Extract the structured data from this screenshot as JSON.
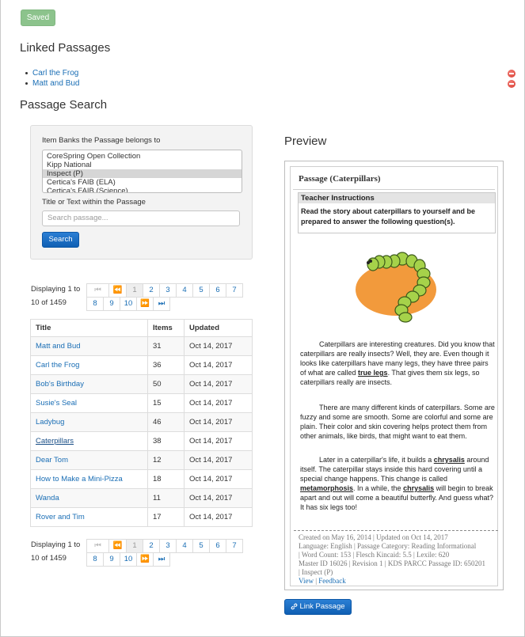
{
  "saved_button": "Saved",
  "linked": {
    "heading": "Linked Passages",
    "items": [
      "Carl the Frog",
      "Matt and Bud"
    ]
  },
  "search": {
    "heading": "Passage Search",
    "banks_label": "Item Banks the Passage belongs to",
    "banks": [
      {
        "label": "CoreSpring Open Collection",
        "selected": false
      },
      {
        "label": "Kipp National",
        "selected": false
      },
      {
        "label": "Inspect (P)",
        "selected": true
      },
      {
        "label": "Certica's FAIB (ELA)",
        "selected": false
      },
      {
        "label": "Certica's FAIB (Science)",
        "selected": false
      }
    ],
    "title_label": "Title or Text within the Passage",
    "input_placeholder": "Search passage...",
    "input_value": "",
    "search_button": "Search"
  },
  "pagination": {
    "displaying_line1": "Displaying 1 to",
    "displaying_line2": "10 of 1459",
    "first": "⏮",
    "prev": "⏪",
    "pages": [
      "1",
      "2",
      "3",
      "4",
      "5",
      "6",
      "7",
      "8",
      "9",
      "10"
    ],
    "active_page": "1",
    "next": "⏩",
    "last": "⏭"
  },
  "table": {
    "columns": [
      "Title",
      "Items",
      "Updated"
    ],
    "rows": [
      {
        "title": "Matt and Bud",
        "items": "31",
        "updated": "Oct 14, 2017"
      },
      {
        "title": "Carl the Frog",
        "items": "36",
        "updated": "Oct 14, 2017"
      },
      {
        "title": "Bob's Birthday",
        "items": "50",
        "updated": "Oct 14, 2017"
      },
      {
        "title": "Susie's Seal",
        "items": "15",
        "updated": "Oct 14, 2017"
      },
      {
        "title": "Ladybug",
        "items": "46",
        "updated": "Oct 14, 2017"
      },
      {
        "title": "Caterpillars",
        "items": "38",
        "updated": "Oct 14, 2017"
      },
      {
        "title": "Dear Tom",
        "items": "12",
        "updated": "Oct 14, 2017"
      },
      {
        "title": "How to Make a Mini-Pizza",
        "items": "18",
        "updated": "Oct 14, 2017"
      },
      {
        "title": "Wanda",
        "items": "11",
        "updated": "Oct 14, 2017"
      },
      {
        "title": "Rover and Tim",
        "items": "17",
        "updated": "Oct 14, 2017"
      }
    ],
    "current_title": "Caterpillars"
  },
  "preview": {
    "heading": "Preview",
    "passage_title": "Passage (Caterpillars)",
    "teacher_instructions_heading": "Teacher Instructions",
    "teacher_instructions_text": "Read the story about caterpillars to yourself and be prepared to answer the following question(s).",
    "para1_a": "Caterpillars are interesting creatures.  Did you know that caterpillars are really insects?  Well, they are.  Even though it looks like caterpillars have many legs, they have three pairs of what are called ",
    "para1_kw": "true legs",
    "para1_b": ".  That gives them six legs, so caterpillars really are insects.",
    "para2": "There are many different kinds of caterpillars.  Some are fuzzy and some are smooth.  Some are colorful and some are plain.  Their color and skin covering helps protect them from other animals, like birds, that might want to eat them.",
    "para3_a": "Later in a caterpillar's life, it builds a ",
    "para3_kw1": "chrysalis",
    "para3_b": " around itself. The caterpillar stays inside this hard covering until a special change happens.  This change is called ",
    "para3_kw2": "metamorphosis",
    "para3_c": ".  In a while, the ",
    "para3_kw3": "chrysalis",
    "para3_d": "  will begin to break apart and out will come a beautiful butterfly. And guess what?  It has six legs too!",
    "meta_line1": "Created on May 16, 2014 | Updated on Oct 14, 2017",
    "meta_line2": "Language: English | Passage Category: Reading Informational",
    "meta_line3": "| Word Count: 153 | Flesch Kincaid: 5.5 | Lexile: 620",
    "meta_line4": "Master ID 16026 | Revision 1 | KDS PARCC Passage ID: 650201",
    "meta_line5": "| Inspect (P)",
    "view_link": "View",
    "separator": "|",
    "feedback_link": "Feedback"
  },
  "link_passage_button": "Link Passage",
  "icons": {
    "remove": "remove-circle-icon",
    "link": "link-icon",
    "image": "caterpillar-illustration"
  },
  "colors": {
    "primary": "#1a6eb5",
    "saved": "#8cc38c",
    "remove": "#d63c31"
  }
}
